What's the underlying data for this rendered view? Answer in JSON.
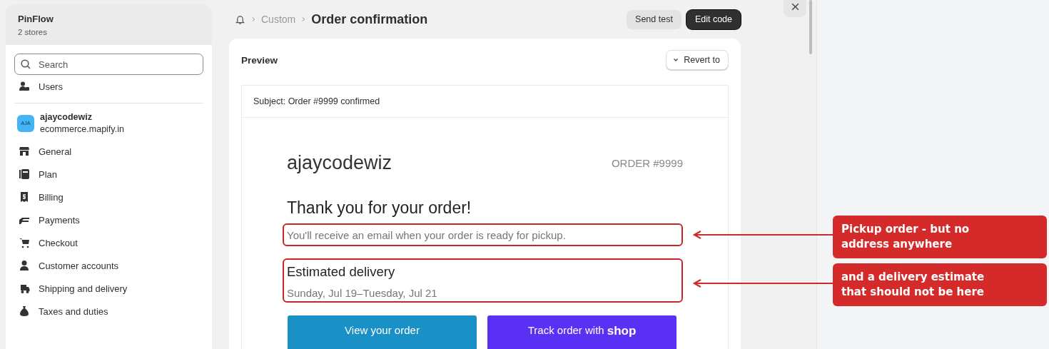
{
  "sidebar": {
    "title": "PinFlow",
    "subtitle": "2 stores",
    "search": {
      "placeholder": "Search"
    },
    "top_items": [
      {
        "label": "Users"
      }
    ],
    "store": {
      "avatar": "AJA",
      "name": "ajaycodewiz",
      "domain": "ecommerce.mapify.in"
    },
    "items": [
      {
        "label": "General"
      },
      {
        "label": "Plan"
      },
      {
        "label": "Billing"
      },
      {
        "label": "Payments"
      },
      {
        "label": "Checkout"
      },
      {
        "label": "Customer accounts"
      },
      {
        "label": "Shipping and delivery"
      },
      {
        "label": "Taxes and duties"
      }
    ]
  },
  "header": {
    "breadcrumb": [
      "Custom"
    ],
    "title": "Order confirmation",
    "actions": [
      {
        "label": "Send test",
        "kind": "secondary"
      },
      {
        "label": "Edit code",
        "kind": "primary"
      }
    ]
  },
  "preview": {
    "title": "Preview",
    "revert": "Revert to",
    "subject": "Subject: Order #9999 confirmed",
    "email": {
      "shop_name": "ajaycodewiz",
      "order_number": "ORDER #9999",
      "heading": "Thank you for your order!",
      "message": "You'll receive an email when your order is ready for pickup.",
      "delivery_title": "Estimated delivery",
      "delivery_dates": "Sunday, Jul 19–Tuesday, Jul 21",
      "buttons": [
        {
          "label": "View your order",
          "kind": "view"
        },
        {
          "label": "Track order with",
          "logo": "shop",
          "kind": "shop"
        }
      ]
    }
  },
  "annotations": [
    {
      "text": "Pickup order - but no address anywhere"
    },
    {
      "text": "and a delivery estimate that should not be here"
    }
  ]
}
